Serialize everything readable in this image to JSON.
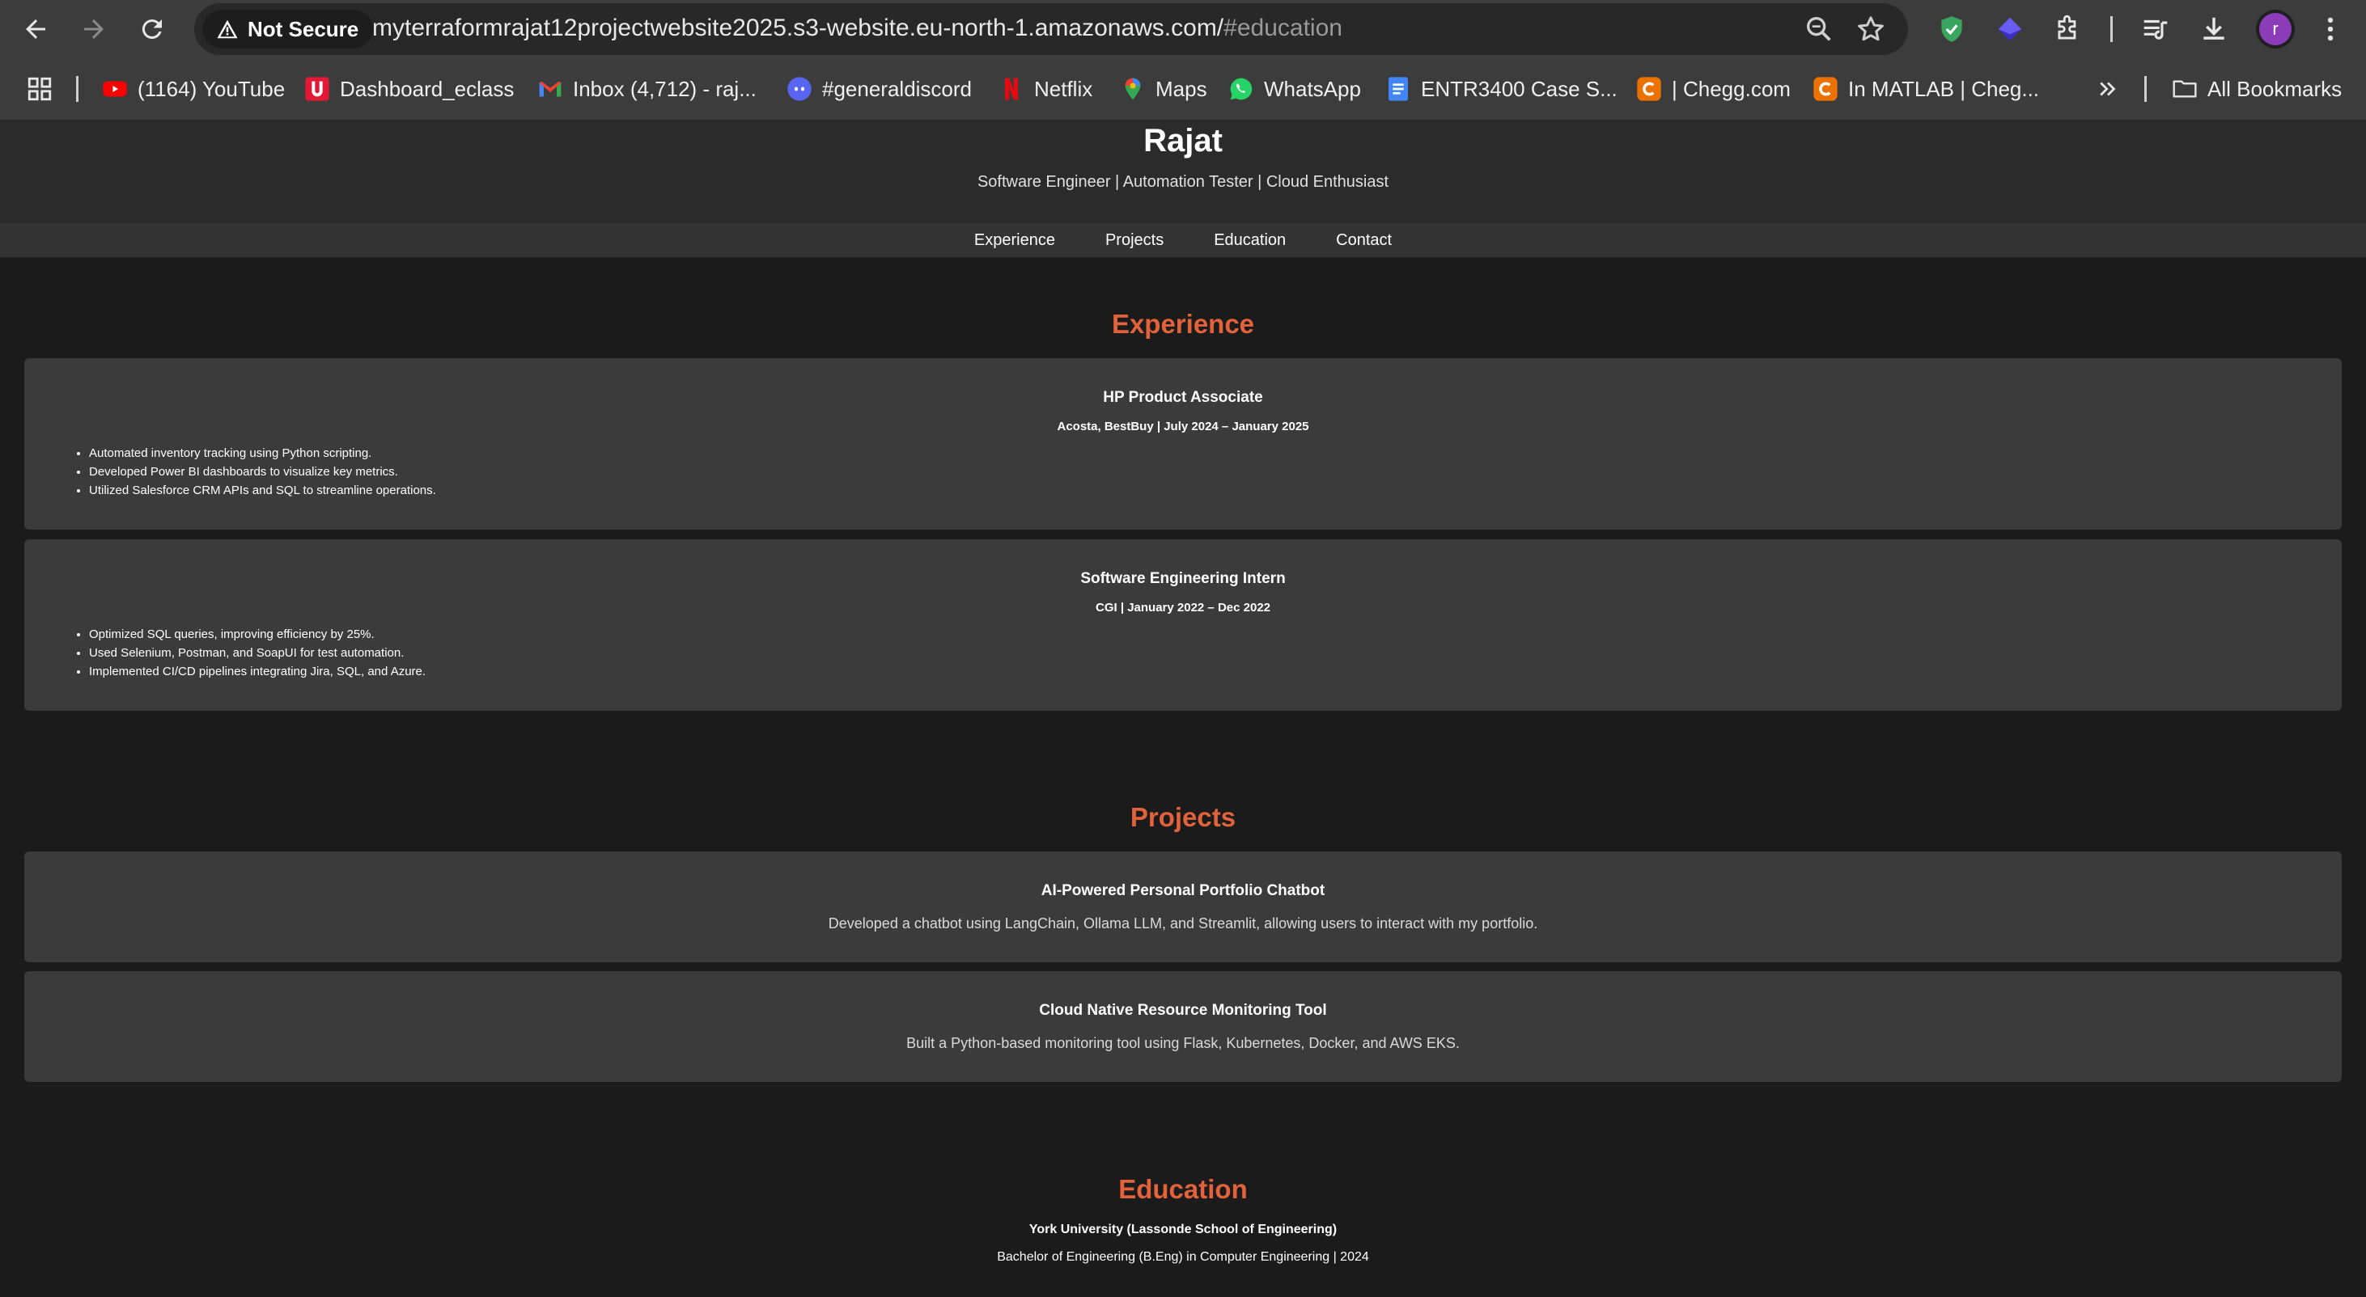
{
  "browser": {
    "security_label": "Not Secure",
    "url_main": "myterraformrajat12projectwebsite2025.s3-website.eu-north-1.amazonaws.com/",
    "url_hash": "#education",
    "avatar_letter": "r",
    "bookmarks": [
      {
        "label": "(1164) YouTube",
        "icon": "youtube-icon"
      },
      {
        "label": "Dashboard_eclass",
        "icon": "eclass-icon"
      },
      {
        "label": "Inbox (4,712) - raj...",
        "icon": "gmail-icon"
      },
      {
        "label": "#generaldiscord",
        "icon": "discord-icon"
      },
      {
        "label": "Netflix",
        "icon": "netflix-icon"
      },
      {
        "label": "Maps",
        "icon": "maps-icon"
      },
      {
        "label": "WhatsApp",
        "icon": "whatsapp-icon"
      },
      {
        "label": "ENTR3400 Case S...",
        "icon": "docs-icon"
      },
      {
        "label": "| Chegg.com",
        "icon": "chegg-icon"
      },
      {
        "label": "In MATLAB | Cheg...",
        "icon": "chegg-icon"
      }
    ],
    "all_bookmarks_label": "All Bookmarks"
  },
  "site": {
    "name": "Rajat",
    "tagline": "Software Engineer | Automation Tester | Cloud Enthusiast",
    "nav": [
      "Experience",
      "Projects",
      "Education",
      "Contact"
    ]
  },
  "experience": {
    "title": "Experience",
    "jobs": [
      {
        "role": "HP Product Associate",
        "meta": "Acosta, BestBuy | July 2024 – January 2025",
        "points": [
          "Automated inventory tracking using Python scripting.",
          "Developed Power BI dashboards to visualize key metrics.",
          "Utilized Salesforce CRM APIs and SQL to streamline operations."
        ]
      },
      {
        "role": "Software Engineering Intern",
        "meta": "CGI | January 2022 – Dec 2022",
        "points": [
          "Optimized SQL queries, improving efficiency by 25%.",
          "Used Selenium, Postman, and SoapUI for test automation.",
          "Implemented CI/CD pipelines integrating Jira, SQL, and Azure."
        ]
      }
    ]
  },
  "projects": {
    "title": "Projects",
    "items": [
      {
        "name": "AI-Powered Personal Portfolio Chatbot",
        "description": "Developed a chatbot using LangChain, Ollama LLM, and Streamlit, allowing users to interact with my portfolio."
      },
      {
        "name": "Cloud Native Resource Monitoring Tool",
        "description": "Built a Python-based monitoring tool using Flask, Kubernetes, Docker, and AWS EKS."
      }
    ]
  },
  "education": {
    "title": "Education",
    "school": "York University (Lassonde School of Engineering)",
    "degree": "Bachelor of Engineering (B.Eng) in Computer Engineering | 2024"
  },
  "colors": {
    "accent": "#e2623c",
    "page_bg": "#1b1b1b",
    "card_bg": "#3b3b3b",
    "header_bg": "#2b2b2b"
  }
}
